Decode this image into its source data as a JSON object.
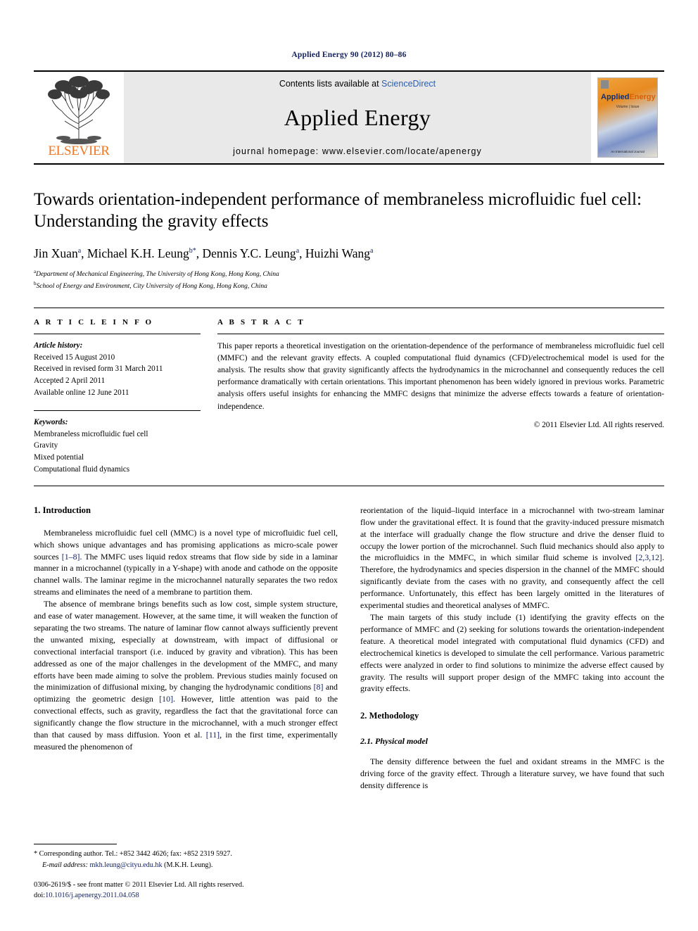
{
  "running_head": "Applied Energy 90 (2012) 80–86",
  "masthead": {
    "contents_prefix": "Contents lists available at ",
    "sciencedirect": "ScienceDirect",
    "journal_title": "Applied Energy",
    "homepage": "journal homepage: www.elsevier.com/locate/apenergy",
    "publisher_name": "ELSEVIER",
    "cover": {
      "title_part1": "Applied",
      "title_part2": "Energy",
      "subtitle": "Volume | Issue",
      "footer_text": "An International Journal"
    }
  },
  "title": "Towards orientation-independent performance of membraneless microfluidic fuel cell: Understanding the gravity effects",
  "authors": [
    {
      "name": "Jin Xuan",
      "mark": "a"
    },
    {
      "name": "Michael K.H. Leung",
      "mark": "b*"
    },
    {
      "name": "Dennis Y.C. Leung",
      "mark": "a"
    },
    {
      "name": "Huizhi Wang",
      "mark": "a"
    }
  ],
  "affiliations": [
    {
      "mark": "a",
      "text": "Department of Mechanical Engineering, The University of Hong Kong, Hong Kong, China"
    },
    {
      "mark": "b",
      "text": "School of Energy and Environment, City University of Hong Kong, Hong Kong, China"
    }
  ],
  "article_info": {
    "heading": "A R T I C L E   I N F O",
    "history_label": "Article history:",
    "history": [
      "Received 15 August 2010",
      "Received in revised form 31 March 2011",
      "Accepted 2 April 2011",
      "Available online 12 June 2011"
    ],
    "keywords_label": "Keywords:",
    "keywords": [
      "Membraneless microfluidic fuel cell",
      "Gravity",
      "Mixed potential",
      "Computational fluid dynamics"
    ]
  },
  "abstract": {
    "heading": "A B S T R A C T",
    "text": "This paper reports a theoretical investigation on the orientation-dependence of the performance of membraneless microfluidic fuel cell (MMFC) and the relevant gravity effects. A coupled computational fluid dynamics (CFD)/electrochemical model is used for the analysis. The results show that gravity significantly affects the hydrodynamics in the microchannel and consequently reduces the cell performance dramatically with certain orientations. This important phenomenon has been widely ignored in previous works. Parametric analysis offers useful insights for enhancing the MMFC designs that minimize the adverse effects towards a feature of orientation-independence.",
    "copyright": "© 2011 Elsevier Ltd. All rights reserved."
  },
  "sections": {
    "introduction_heading": "1. Introduction",
    "methodology_heading": "2. Methodology",
    "physical_model_heading": "2.1. Physical model"
  },
  "left_column": {
    "p1_a": "Membraneless microfluidic fuel cell (MMC) is a novel type of microfluidic fuel cell, which shows unique advantages and has promising applications as micro-scale power sources ",
    "p1_cite": "[1–8]",
    "p1_b": ". The MMFC uses liquid redox streams that flow side by side in a laminar manner in a microchannel (typically in a Y-shape) with anode and cathode on the opposite channel walls. The laminar regime in the microchannel naturally separates the two redox streams and eliminates the need of a membrane to partition them.",
    "p2_a": "The absence of membrane brings benefits such as low cost, simple system structure, and ease of water management. However, at the same time, it will weaken the function of separating the two streams. The nature of laminar flow cannot always sufficiently prevent the unwanted mixing, especially at downstream, with impact of diffusional or convectional interfacial transport (i.e. induced by gravity and vibration). This has been addressed as one of the major challenges in the development of the MMFC, and many efforts have been made aiming to solve the problem. Previous studies mainly focused on the minimization of diffusional mixing, by changing the hydrodynamic conditions ",
    "p2_cite1": "[8]",
    "p2_b": " and optimizing the geometric design ",
    "p2_cite2": "[10]",
    "p2_c": ". However, little attention was paid to the convectional effects, such as gravity, regardless the fact that the gravitational force can significantly change the flow structure in the microchannel, with a much stronger effect than that caused by mass diffusion. Yoon et al. ",
    "p2_cite3": "[11]",
    "p2_d": ", in the first time, experimentally measured the phenomenon of"
  },
  "right_column": {
    "p1_a": "reorientation of the liquid–liquid interface in a microchannel with two-stream laminar flow under the gravitational effect. It is found that the gravity-induced pressure mismatch at the interface will gradually change the flow structure and drive the denser fluid to occupy the lower portion of the microchannel. Such fluid mechanics should also apply to the microfluidics in the MMFC, in which similar fluid scheme is involved ",
    "p1_cite": "[2,3,12]",
    "p1_b": ". Therefore, the hydrodynamics and species dispersion in the channel of the MMFC should significantly deviate from the cases with no gravity, and consequently affect the cell performance. Unfortunately, this effect has been largely omitted in the literatures of experimental studies and theoretical analyses of MMFC.",
    "p2": "The main targets of this study include (1) identifying the gravity effects on the performance of MMFC and (2) seeking for solutions towards the orientation-independent feature. A theoretical model integrated with computational fluid dynamics (CFD) and electrochemical kinetics is developed to simulate the cell performance. Various parametric effects were analyzed in order to find solutions to minimize the adverse effect caused by gravity. The results will support proper design of the MMFC taking into account the gravity effects.",
    "p3": "The density difference between the fuel and oxidant streams in the MMFC is the driving force of the gravity effect. Through a literature survey, we have found that such density difference is"
  },
  "footnote": {
    "corresponding": "* Corresponding author. Tel.: +852 3442 4626; fax: +852 2319 5927.",
    "email_label": "E-mail address:",
    "email": "mkh.leung@cityu.edu.hk",
    "email_suffix": "(M.K.H. Leung)."
  },
  "footer": {
    "issn_line": "0306-2619/$ - see front matter © 2011 Elsevier Ltd. All rights reserved.",
    "doi_label": "doi:",
    "doi": "10.1016/j.apenergy.2011.04.058"
  },
  "colors": {
    "link": "#12205e",
    "sciencedirect": "#2a5db0",
    "elsevier_orange": "#ef7622",
    "masthead_grey": "#e9e9e9"
  }
}
